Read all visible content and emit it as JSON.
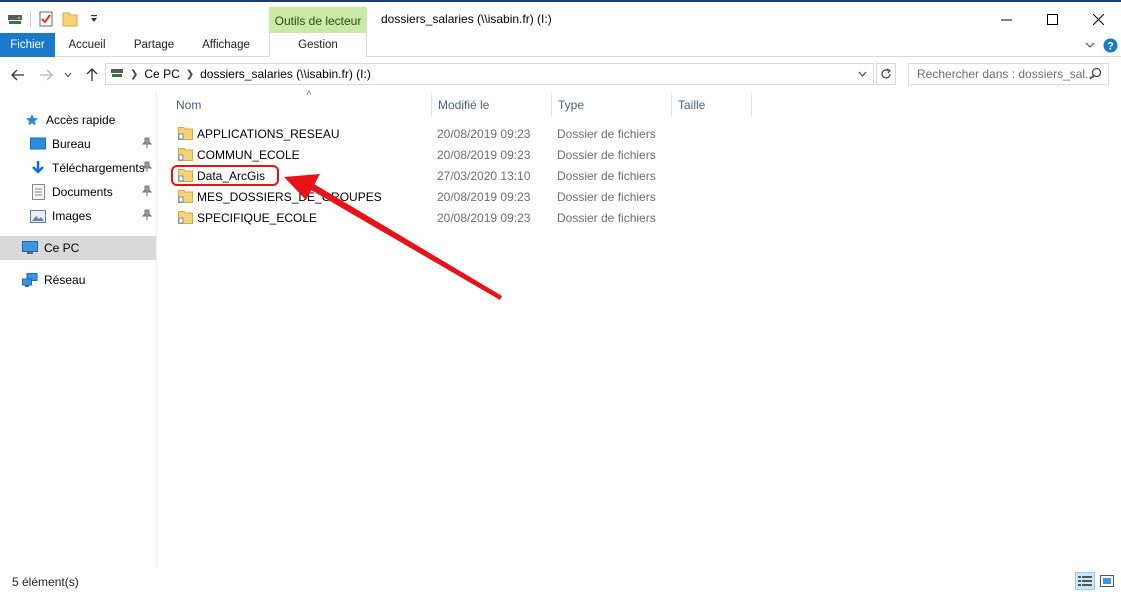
{
  "window": {
    "title": "dossiers_salaries (\\\\isabin.fr) (I:)",
    "context_tab": "Outils de lecteur",
    "accent": "#1979ca",
    "context_color": "#c9e9a7"
  },
  "quick_access_toolbar": {
    "icons": [
      "drive-icon",
      "properties-icon",
      "new-folder-icon",
      "customize-dropdown-icon"
    ]
  },
  "ribbon": {
    "tabs": [
      "Fichier",
      "Accueil",
      "Partage",
      "Affichage"
    ],
    "context_subtab": "Gestion"
  },
  "address_bar": {
    "crumbs": [
      "Ce PC",
      "dossiers_salaries (\\\\isabin.fr) (I:)"
    ]
  },
  "search": {
    "placeholder": "Rechercher dans : dossiers_sal..."
  },
  "navigation_pane": {
    "items": [
      {
        "label": "Accès rapide",
        "icon": "star-icon",
        "pinned": false
      },
      {
        "label": "Bureau",
        "icon": "desktop-icon",
        "pinned": true
      },
      {
        "label": "Téléchargements",
        "icon": "download-icon",
        "pinned": true
      },
      {
        "label": "Documents",
        "icon": "documents-icon",
        "pinned": true
      },
      {
        "label": "Images",
        "icon": "images-icon",
        "pinned": true
      },
      {
        "label": "Ce PC",
        "icon": "computer-icon",
        "pinned": false,
        "selected": true
      },
      {
        "label": "Réseau",
        "icon": "network-icon",
        "pinned": false
      }
    ]
  },
  "file_list": {
    "columns": [
      "Nom",
      "Modifié le",
      "Type",
      "Taille"
    ],
    "rows": [
      {
        "name": "APPLICATIONS_RESEAU",
        "modified": "20/08/2019 09:23",
        "type": "Dossier de fichiers"
      },
      {
        "name": "COMMUN_ECOLE",
        "modified": "20/08/2019 09:23",
        "type": "Dossier de fichiers"
      },
      {
        "name": "Data_ArcGis",
        "modified": "27/03/2020 13:10",
        "type": "Dossier de fichiers"
      },
      {
        "name": "MES_DOSSIERS_DE_GROUPES",
        "modified": "20/08/2019 09:23",
        "type": "Dossier de fichiers"
      },
      {
        "name": "SPECIFIQUE_ECOLE",
        "modified": "20/08/2019 09:23",
        "type": "Dossier de fichiers"
      }
    ]
  },
  "annotation": {
    "color": "#e8131a",
    "target": "Data_ArcGis"
  },
  "status_bar": {
    "count_text": "5 élément(s)"
  }
}
